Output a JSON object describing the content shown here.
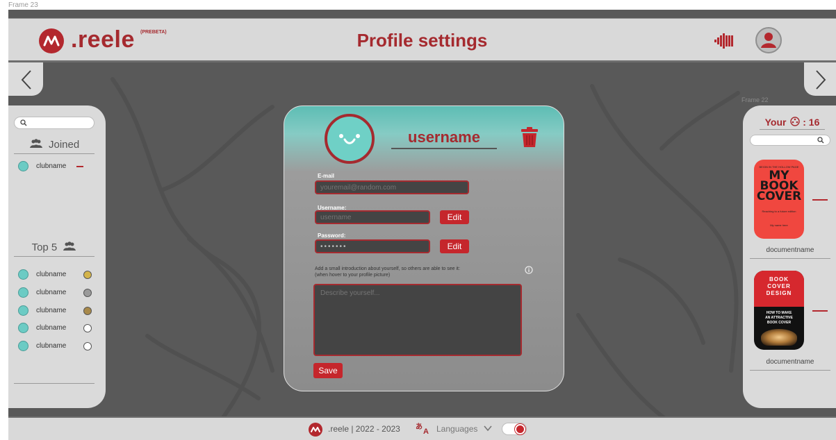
{
  "frame": {
    "label": "Frame 23"
  },
  "header": {
    "brand": ".reele",
    "brand_tag": "(PREBETA)",
    "title": "Profile settings"
  },
  "left_panel": {
    "search_placeholder": "",
    "joined_heading": "Joined",
    "joined": [
      {
        "name": "clubname"
      }
    ],
    "top_heading": "Top 5",
    "top": [
      {
        "name": "clubname",
        "medal_color": "#d4b44a"
      },
      {
        "name": "clubname",
        "medal_color": "#9a9a9a"
      },
      {
        "name": "clubname",
        "medal_color": "#a8894a"
      },
      {
        "name": "clubname",
        "medal_color": "#ffffff"
      },
      {
        "name": "clubname",
        "medal_color": "#ffffff"
      }
    ]
  },
  "right_panel": {
    "frame_label": "Frame 22",
    "your_label": "Your",
    "your_count": ": 16",
    "documents": [
      {
        "name": "documentname",
        "cover_top": "BEGIN IN THE HOLLOW PAGE",
        "cover_title_1": "MY",
        "cover_title_2": "BOOK",
        "cover_title_3": "COVER",
        "cover_sub": "Reaching to a future edition",
        "cover_author": "My name here"
      },
      {
        "name": "documentname",
        "cover_title_1": "BOOK",
        "cover_title_2": "COVER",
        "cover_title_3": "DESIGN",
        "cover_sub_1": "HOW TO MAKE",
        "cover_sub_2": "AN ATTRACTIVE",
        "cover_sub_3": "BOOK COVER"
      }
    ]
  },
  "modal": {
    "username": "username",
    "email_label": "E-mail",
    "email_placeholder": "youremail@random.com",
    "username_label": "Username:",
    "username_placeholder": "username",
    "password_label": "Password:",
    "password_value": "•••••••",
    "edit_label": "Edit",
    "intro_line1": "Add a small introduction about yourself, so others are able to see it:",
    "intro_line2": "(when hover to your profile picture)",
    "describe_placeholder": "Describe yourself...",
    "save_label": "Save"
  },
  "footer": {
    "brand_text": ".reele | 2022 - 2023",
    "languages_label": "Languages"
  },
  "colors": {
    "accent": "#a52a2f",
    "button": "#c5262c",
    "teal": "#6fd0c6"
  }
}
